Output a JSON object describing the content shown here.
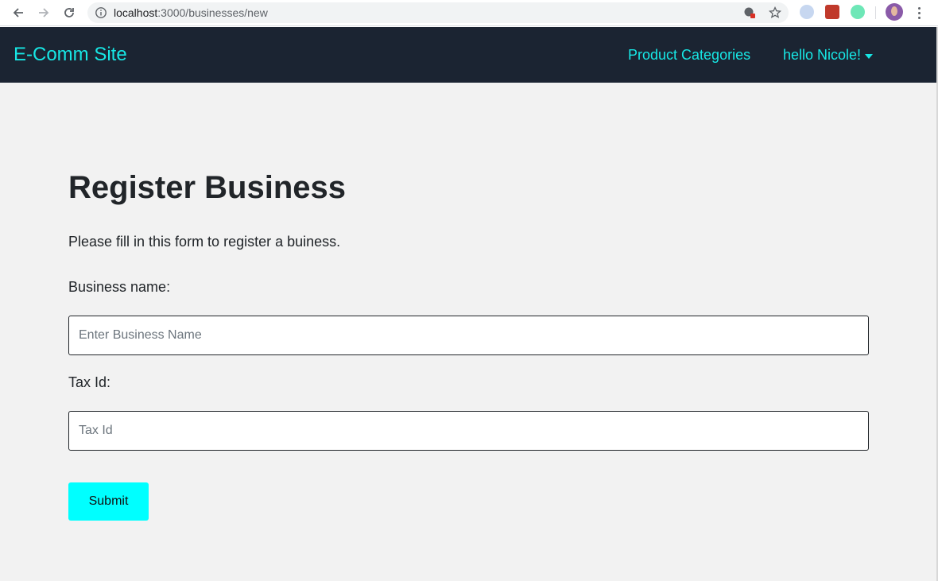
{
  "browser": {
    "url_host": "localhost",
    "url_path": ":3000/businesses/new"
  },
  "navbar": {
    "brand": "E-Comm Site",
    "categories_link": "Product Categories",
    "user_menu": "hello Nicole!"
  },
  "form": {
    "title": "Register Business",
    "description": "Please fill in this form to register a buiness.",
    "business_name_label": "Business name:",
    "business_name_placeholder": "Enter Business Name",
    "tax_id_label": "Tax Id:",
    "tax_id_placeholder": "Tax Id",
    "submit_label": "Submit"
  },
  "colors": {
    "navbar_bg": "#1b2432",
    "accent": "#17e7e5",
    "button_bg": "#00ffff",
    "page_bg": "#f2f2f2"
  }
}
